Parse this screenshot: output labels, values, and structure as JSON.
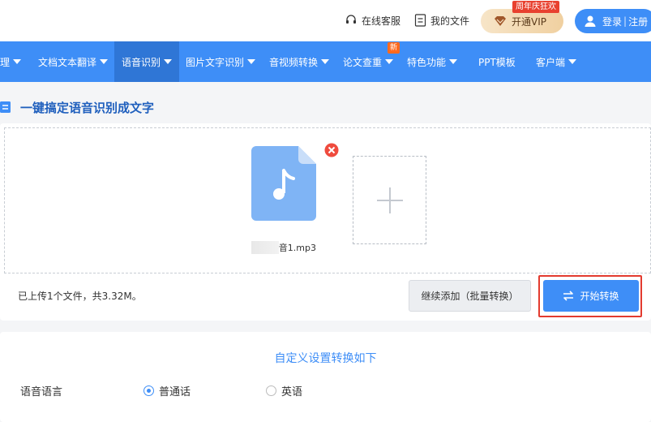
{
  "header": {
    "support_label": "在线客服",
    "my_files_label": "我的文件",
    "vip_label": "开通VIP",
    "vip_badge": "周年庆狂欢",
    "login_label": "登录",
    "separator": "|",
    "register_label": "注册"
  },
  "nav": {
    "items": [
      {
        "label": "理"
      },
      {
        "label": "文档文本翻译"
      },
      {
        "label": "语音识别"
      },
      {
        "label": "图片文字识别"
      },
      {
        "label": "音视频转换"
      },
      {
        "label": "论文查重"
      },
      {
        "label": "特色功能"
      },
      {
        "label": "PPT模板"
      },
      {
        "label": "客户端"
      }
    ],
    "new_badge": "新"
  },
  "page": {
    "title": "一键搞定语音识别成文字"
  },
  "upload": {
    "file_name_suffix": "音1.mp3",
    "summary": "已上传1个文件，共3.32M。",
    "add_more_label": "继续添加（批量转换）",
    "start_label": "开始转换"
  },
  "settings": {
    "title": "自定义设置转换如下",
    "language_label": "语音语言",
    "options": [
      {
        "label": "普通话",
        "selected": true
      },
      {
        "label": "英语",
        "selected": false
      }
    ]
  },
  "colors": {
    "primary": "#3e8ef7",
    "nav_active": "#2f76d6",
    "highlight": "#e33b2f",
    "file_icon": "#7fb4f5"
  }
}
